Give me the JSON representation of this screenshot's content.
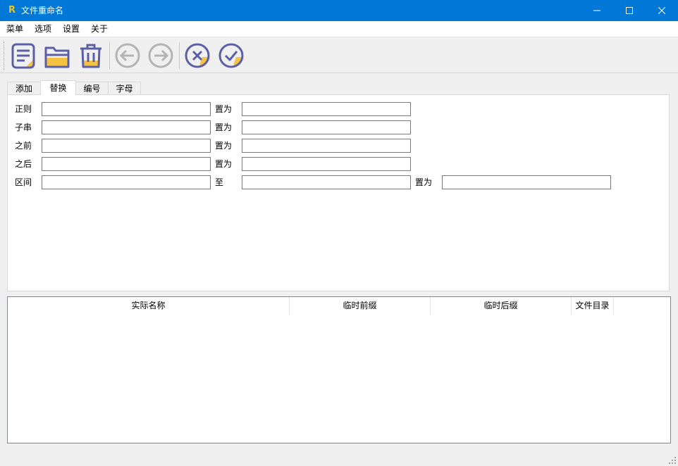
{
  "window": {
    "app_icon_letter": "R",
    "title": "文件重命名"
  },
  "menu": {
    "items": [
      "菜单",
      "选项",
      "设置",
      "关于"
    ]
  },
  "toolbar": {
    "buttons": [
      "document-list-icon",
      "folder-open-icon",
      "trash-icon",
      "back-icon",
      "forward-icon",
      "cancel-icon",
      "confirm-icon"
    ],
    "accent_colors": {
      "icon_stroke": "#5b5fa8",
      "icon_fill": "#f5c242",
      "disabled": "#b4b4b4"
    }
  },
  "tabs": [
    "添加",
    "替换",
    "编号",
    "字母"
  ],
  "active_tab": "替换",
  "replace_form": {
    "rows": [
      {
        "label": "正则",
        "mid_label": "置为",
        "value1": "",
        "value2": ""
      },
      {
        "label": "子串",
        "mid_label": "置为",
        "value1": "",
        "value2": ""
      },
      {
        "label": "之前",
        "mid_label": "置为",
        "value1": "",
        "value2": ""
      },
      {
        "label": "之后",
        "mid_label": "置为",
        "value1": "",
        "value2": ""
      },
      {
        "label": "区间",
        "mid_label": "至",
        "value1": "",
        "value2": "",
        "end_label": "置为",
        "value3": ""
      }
    ]
  },
  "list": {
    "columns": [
      "实际名称",
      "临时前缀",
      "临时后缀",
      "文件目录"
    ],
    "rows": []
  },
  "colors": {
    "titlebar": "#0078d7",
    "window_bg": "#f0f0f0"
  }
}
